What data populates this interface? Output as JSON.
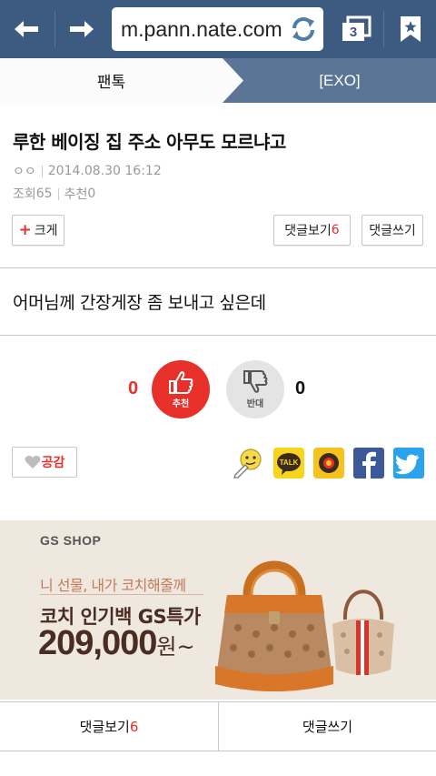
{
  "browser": {
    "url": "m.pann.nate.com",
    "tab_count": "3"
  },
  "breadcrumb": {
    "section": "팬톡",
    "board": "[EXO]"
  },
  "article": {
    "title": "루한 베이징 집 주소 아무도 모르냐고",
    "author": "ㅇㅇ",
    "datetime": "2014.08.30 16:12",
    "views_label": "조회",
    "views": "65",
    "recommend_label": "추천",
    "recommend": "0",
    "body": "어머님께 간장게장 좀 보내고 싶은데"
  },
  "controls": {
    "font_size_label": "크게",
    "view_comments_label": "댓글보기",
    "comment_count": "6",
    "write_comment_label": "댓글쓰기"
  },
  "vote": {
    "up_count": "0",
    "up_label": "추천",
    "down_label": "반대",
    "down_count": "0"
  },
  "share": {
    "empathy_label": "공감",
    "icons": [
      "emoticon-icon",
      "kakaotalk-icon",
      "kakaostory-icon",
      "facebook-icon",
      "twitter-icon"
    ],
    "kakao_talk_text": "TALK"
  },
  "ad": {
    "brand": "GS SHOP",
    "subheadline": "니 선물, 내가 코치해줄께",
    "headline": "코치 인기백 GS특가",
    "price": "209,000",
    "price_unit": "원~"
  },
  "bottom_bar": {
    "view_comments_label": "댓글보기",
    "comment_count": "6",
    "write_comment_label": "댓글쓰기"
  },
  "colors": {
    "toolbar": "#3d5b80",
    "breadcrumb_active": "#5a7596",
    "accent_red": "#e8302a",
    "ad_background": "#eee8df"
  }
}
